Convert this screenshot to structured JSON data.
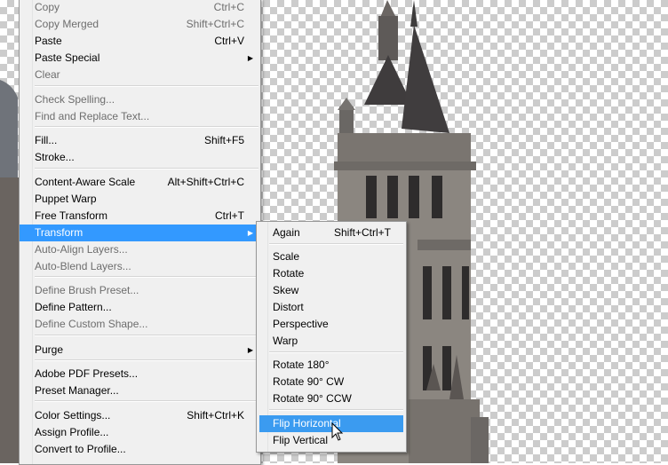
{
  "main_menu": {
    "items": [
      {
        "label": "Copy",
        "shortcut": "Ctrl+C",
        "disabled": true
      },
      {
        "label": "Copy Merged",
        "shortcut": "Shift+Ctrl+C",
        "disabled": true
      },
      {
        "label": "Paste",
        "shortcut": "Ctrl+V"
      },
      {
        "label": "Paste Special",
        "submenu_arrow": "▶"
      },
      {
        "label": "Clear",
        "disabled": true
      },
      {
        "label": "Check Spelling...",
        "disabled": true
      },
      {
        "label": "Find and Replace Text...",
        "disabled": true
      },
      {
        "label": "Fill...",
        "shortcut": "Shift+F5"
      },
      {
        "label": "Stroke..."
      },
      {
        "label": "Content-Aware Scale",
        "shortcut": "Alt+Shift+Ctrl+C"
      },
      {
        "label": "Puppet Warp"
      },
      {
        "label": "Free Transform",
        "shortcut": "Ctrl+T"
      },
      {
        "label": "Transform",
        "submenu_arrow": "▶",
        "highlighted": true
      },
      {
        "label": "Auto-Align Layers...",
        "disabled": true
      },
      {
        "label": "Auto-Blend Layers...",
        "disabled": true
      },
      {
        "label": "Define Brush Preset...",
        "disabled": true
      },
      {
        "label": "Define Pattern..."
      },
      {
        "label": "Define Custom Shape...",
        "disabled": true
      },
      {
        "label": "Purge",
        "submenu_arrow": "▶"
      },
      {
        "label": "Adobe PDF Presets..."
      },
      {
        "label": "Preset Manager..."
      },
      {
        "label": "Color Settings...",
        "shortcut": "Shift+Ctrl+K"
      },
      {
        "label": "Assign Profile..."
      },
      {
        "label": "Convert to Profile..."
      }
    ]
  },
  "transform_submenu": {
    "items": [
      {
        "label": "Again",
        "shortcut": "Shift+Ctrl+T"
      },
      {
        "label": "Scale"
      },
      {
        "label": "Rotate"
      },
      {
        "label": "Skew"
      },
      {
        "label": "Distort"
      },
      {
        "label": "Perspective"
      },
      {
        "label": "Warp"
      },
      {
        "label": "Rotate 180°"
      },
      {
        "label": "Rotate 90° CW"
      },
      {
        "label": "Rotate 90° CCW"
      },
      {
        "label": "Flip Horizontal",
        "highlighted": true
      },
      {
        "label": "Flip Vertical"
      }
    ]
  },
  "colors": {
    "highlight": "#3399ff",
    "menu_bg": "#f0f0f0",
    "disabled_text": "#6d6d6d",
    "checker": "#cccccc"
  },
  "icons": {
    "cursor": "arrow-pointer-icon",
    "submenu_arrow": "triangle-right-icon"
  }
}
